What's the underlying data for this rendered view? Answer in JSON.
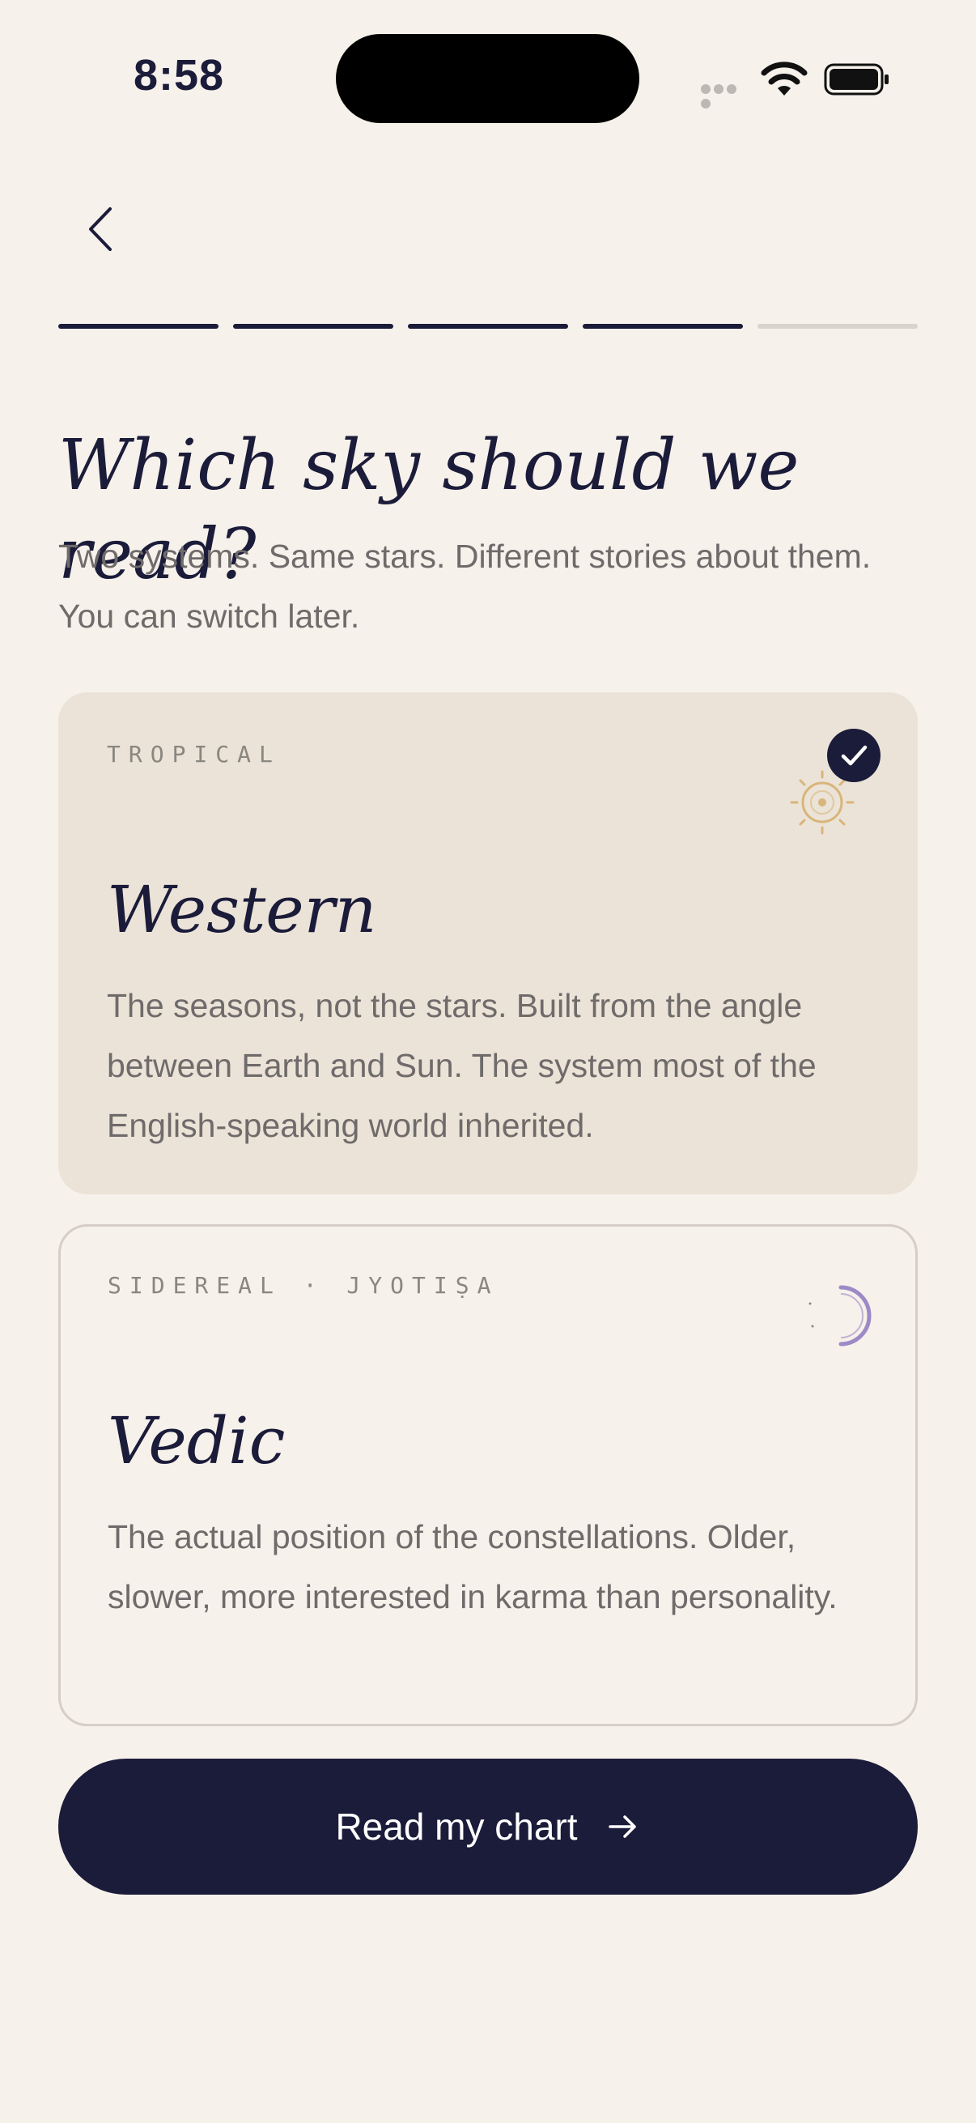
{
  "status": {
    "time": "8:58"
  },
  "progress": {
    "total_steps": 5,
    "current_step": 4
  },
  "header": {
    "title": "Which sky should we read?",
    "subtitle": "Two systems. Same stars. Different stories about them. You can switch later."
  },
  "options": [
    {
      "eyebrow": "TROPICAL",
      "title": "Western",
      "description": "The seasons, not the stars. Built from the angle between Earth and Sun. The system most of the English-speaking world inherited.",
      "selected": true,
      "icon": "sun-icon"
    },
    {
      "eyebrow": "SIDEREAL · JYOTIṢA",
      "title": "Vedic",
      "description": "The actual position of the constellations. Older, slower, more interested in karma than personality.",
      "selected": false,
      "icon": "moon-icon"
    }
  ],
  "cta": {
    "label": "Read my chart",
    "icon": "arrow-right-icon"
  },
  "colors": {
    "background": "#f6f1ea",
    "ink": "#1b1b3a",
    "selected_card": "#ebe3d7",
    "sun": "#d8b57a",
    "moon": "#9b8ac7"
  }
}
